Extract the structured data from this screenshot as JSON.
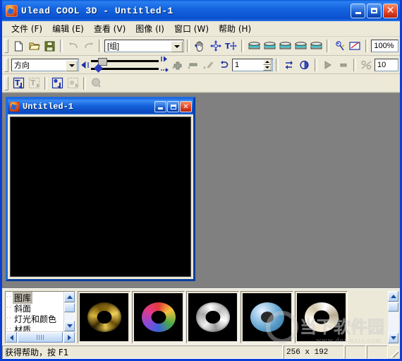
{
  "window": {
    "title": "Ulead COOL 3D - Untitled-1",
    "icon": "ulead-cool3d-icon",
    "controls": {
      "minimize": "_",
      "maximize": "□",
      "close": "×"
    }
  },
  "menubar": {
    "items": [
      {
        "label": "文件 (F)",
        "name": "menu-file"
      },
      {
        "label": "编辑 (E)",
        "name": "menu-edit"
      },
      {
        "label": "查看 (V)",
        "name": "menu-view"
      },
      {
        "label": "图像 (I)",
        "name": "menu-image"
      },
      {
        "label": "窗口 (W)",
        "name": "menu-window"
      },
      {
        "label": "帮助 (H)",
        "name": "menu-help"
      }
    ]
  },
  "toolbar_main": {
    "buttons": [
      {
        "name": "new-file-button",
        "icon": "new-document-icon",
        "enabled": true
      },
      {
        "name": "open-file-button",
        "icon": "open-folder-icon",
        "enabled": true
      },
      {
        "name": "save-file-button",
        "icon": "floppy-disk-icon",
        "enabled": true
      },
      {
        "name": "undo-button",
        "icon": "undo-arrow-icon",
        "enabled": false
      },
      {
        "name": "redo-button",
        "icon": "redo-arrow-icon",
        "enabled": false
      }
    ],
    "object_combo": {
      "value": "[组]",
      "name": "object-select-combo"
    },
    "tools": [
      {
        "name": "pan-tool-button",
        "icon": "hand-pan-icon"
      },
      {
        "name": "rotate-tool-button",
        "icon": "rotate-object-icon"
      },
      {
        "name": "text-tool-button",
        "icon": "text-move-icon"
      }
    ],
    "view_buttons": [
      {
        "name": "view-button-1",
        "icon": "box-view-icon"
      },
      {
        "name": "view-button-2",
        "icon": "box-view-icon"
      },
      {
        "name": "view-button-3",
        "icon": "box-view-icon"
      },
      {
        "name": "view-button-4",
        "icon": "box-view-icon"
      },
      {
        "name": "view-button-5",
        "icon": "box-view-icon"
      }
    ],
    "extra_buttons": [
      {
        "name": "eyedropper-button",
        "icon": "eyedropper-icon"
      },
      {
        "name": "preview-button",
        "icon": "preview-pen-icon"
      }
    ],
    "zoom_field": {
      "value": "100%",
      "name": "zoom-level-field"
    }
  },
  "toolbar_attrib": {
    "property_combo": {
      "value": "方向",
      "name": "property-select-combo"
    },
    "slider_top": {
      "name": "value-slider-top",
      "position_pct": 12
    },
    "slider_bottom": {
      "name": "value-slider-bottom",
      "position_pct": 7
    },
    "nudge_left_top": {
      "name": "step-left-button",
      "icon": "step-left-icon"
    },
    "nudge_right_top": {
      "name": "step-right-button",
      "icon": "step-right-icon"
    },
    "nudge_left_bottom": {
      "name": "arrow-left-button",
      "icon": "arrow-left-icon"
    },
    "nudge_right_bottom": {
      "name": "arrow-right-button",
      "icon": "arrow-right-icon"
    },
    "plus_button": {
      "name": "add-button",
      "icon": "plus-icon"
    },
    "minus_button": {
      "name": "remove-button",
      "icon": "minus-icon"
    },
    "loop_button": {
      "name": "loop-button",
      "icon": "loop-arrow-icon"
    },
    "frame_spinner": {
      "value": "1",
      "name": "frame-number-spinner"
    },
    "anim_buttons": [
      {
        "name": "swap-frames-button",
        "icon": "swap-arrows-icon"
      },
      {
        "name": "circle-frame-button",
        "icon": "circle-split-icon"
      },
      {
        "name": "play-button",
        "icon": "play-triangle-icon"
      },
      {
        "name": "stop-button",
        "icon": "stop-square-icon"
      },
      {
        "name": "percent-button",
        "icon": "percent-slash-icon"
      }
    ],
    "frames_field": {
      "value": "10",
      "name": "total-frames-field"
    }
  },
  "toolbar_object": {
    "buttons": [
      {
        "name": "insert-text-button",
        "icon": "text-insert-icon",
        "enabled": true
      },
      {
        "name": "edit-text-button",
        "icon": "text-edit-icon",
        "enabled": false
      },
      {
        "name": "insert-object-button",
        "icon": "object-insert-icon",
        "enabled": true
      },
      {
        "name": "edit-object-button",
        "icon": "object-edit-icon",
        "enabled": false
      },
      {
        "name": "sphere-object-button",
        "icon": "sphere-icon",
        "enabled": false
      }
    ]
  },
  "document": {
    "title": "Untitled-1",
    "icon": "document-icon",
    "controls": {
      "minimize": "_",
      "maximize": "□",
      "close": "×"
    },
    "canvas_bg": "#000000"
  },
  "gallery": {
    "tree": {
      "items": [
        {
          "label": "图库",
          "selected": true
        },
        {
          "label": "斜面",
          "selected": false
        },
        {
          "label": "灯光和颜色",
          "selected": false
        },
        {
          "label": "材质",
          "selected": false
        }
      ]
    },
    "thumbnails": [
      {
        "name": "gallery-thumb-1",
        "style": "t-gold",
        "label": "gold-fragments-torus"
      },
      {
        "name": "gallery-thumb-2",
        "style": "t-color",
        "label": "multicolor-torus"
      },
      {
        "name": "gallery-thumb-3",
        "style": "t-white",
        "label": "white-carved-torus"
      },
      {
        "name": "gallery-thumb-4",
        "style": "t-blue",
        "label": "blue-marble-torus"
      },
      {
        "name": "gallery-thumb-5",
        "style": "t-ivory",
        "label": "ivory-swirl-torus"
      }
    ]
  },
  "watermark": {
    "text": "当下软件园",
    "url": "www.downxia.com"
  },
  "statusbar": {
    "hint": "获得帮助，按 F1",
    "size": "256 x 192",
    "cell_a": "",
    "cell_b": ""
  },
  "colors": {
    "title_blue": "#1565e0",
    "face": "#ece9d8",
    "workspace_gray": "#808080",
    "accent_border": "#0a3fd6"
  }
}
